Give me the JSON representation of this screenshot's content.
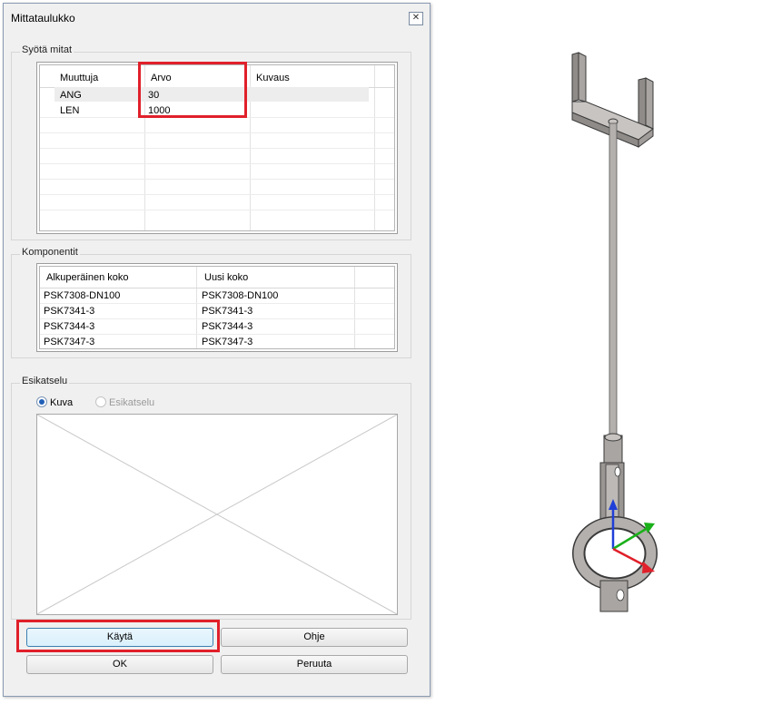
{
  "dialog": {
    "title": "Mittataulukko",
    "close_glyph": "✕"
  },
  "dimensions": {
    "group_label": "Syötä mitat",
    "headers": [
      "Muuttuja",
      "Arvo",
      "Kuvaus"
    ],
    "rows": [
      {
        "variable": "ANG",
        "value": "30",
        "description": ""
      },
      {
        "variable": "LEN",
        "value": "1000",
        "description": ""
      }
    ]
  },
  "components": {
    "group_label": "Komponentit",
    "headers": [
      "Alkuperäinen koko",
      "Uusi koko"
    ],
    "rows": [
      {
        "original": "PSK7308-DN100",
        "new": "PSK7308-DN100"
      },
      {
        "original": "PSK7341-3",
        "new": "PSK7341-3"
      },
      {
        "original": "PSK7344-3",
        "new": "PSK7344-3"
      },
      {
        "original": "PSK7347-3",
        "new": "PSK7347-3"
      }
    ]
  },
  "preview": {
    "group_label": "Esikatselu",
    "options": [
      {
        "label": "Kuva",
        "selected": true,
        "enabled": true
      },
      {
        "label": "Esikatselu",
        "selected": false,
        "enabled": false
      }
    ]
  },
  "buttons": {
    "apply": "Käytä",
    "help": "Ohje",
    "ok": "OK",
    "cancel": "Peruuta"
  },
  "colors": {
    "highlight": "#e0202a",
    "axis_x": "#e0202a",
    "axis_y": "#19b019",
    "axis_z": "#1f3fd8",
    "model_gray": "#b4b0ad"
  },
  "icons": {
    "close": "close-icon",
    "preview_placeholder": "image-placeholder-icon",
    "triad": "coordinate-triad-icon"
  }
}
